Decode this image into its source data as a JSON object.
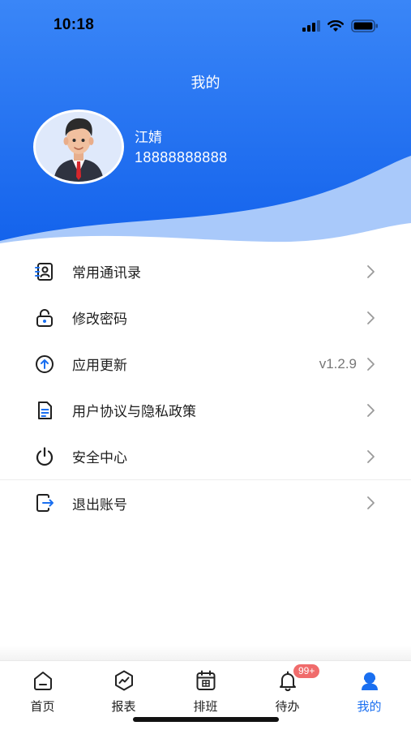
{
  "status_bar": {
    "time": "10:18"
  },
  "header": {
    "title": "我的",
    "user": {
      "name": "江婧",
      "phone": "18888888888"
    }
  },
  "colors": {
    "primary_blue": "#1a6ff0",
    "header_light_blue": "#9ac0f9",
    "badge_red": "#f06b6b"
  },
  "menu": {
    "items": [
      {
        "label": "常用通讯录",
        "icon": "contacts-icon",
        "value": ""
      },
      {
        "label": "修改密码",
        "icon": "lock-icon",
        "value": ""
      },
      {
        "label": "应用更新",
        "icon": "update-icon",
        "value": "v1.2.9"
      },
      {
        "label": "用户协议与隐私政策",
        "icon": "document-icon",
        "value": ""
      },
      {
        "label": "安全中心",
        "icon": "power-icon",
        "value": ""
      },
      {
        "label": "退出账号",
        "icon": "logout-icon",
        "value": ""
      }
    ]
  },
  "tabbar": {
    "tabs": [
      {
        "label": "首页",
        "icon": "home-icon",
        "active": false
      },
      {
        "label": "报表",
        "icon": "chart-icon",
        "active": false
      },
      {
        "label": "排班",
        "icon": "calendar-icon",
        "active": false
      },
      {
        "label": "待办",
        "icon": "bell-icon",
        "active": false,
        "badge": "99+"
      },
      {
        "label": "我的",
        "icon": "user-icon",
        "active": true
      }
    ]
  }
}
